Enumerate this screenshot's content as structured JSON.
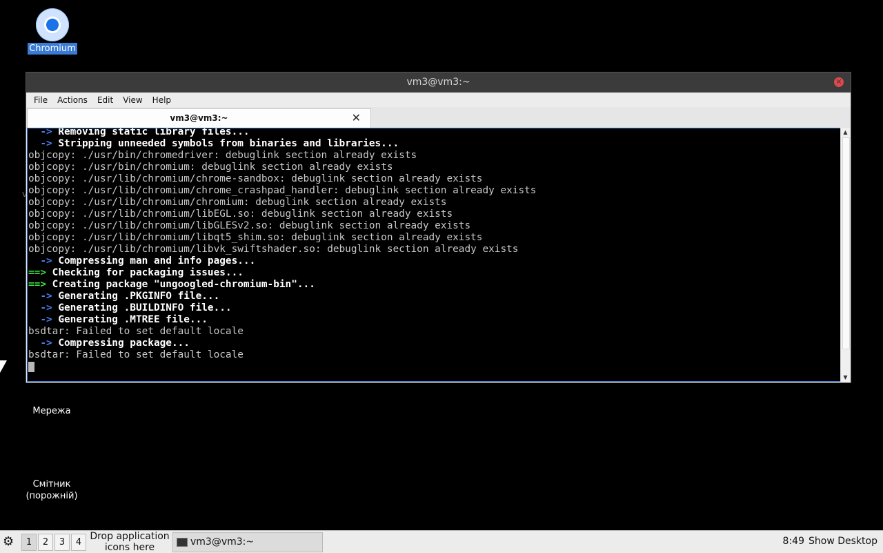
{
  "desktop": {
    "chromium_label": "Chromium",
    "network_label": "Мережа",
    "trash_label": "Смітник (порожній)"
  },
  "window": {
    "title": "vm3@vm3:~",
    "menu": [
      "File",
      "Actions",
      "Edit",
      "View",
      "Help"
    ],
    "tab_title": "vm3@vm3:~",
    "terminal_lines": [
      {
        "prefix": "  -> ",
        "prefix_color": "blue",
        "text": "Removing static library files...",
        "bold": true
      },
      {
        "prefix": "  -> ",
        "prefix_color": "blue",
        "text": "Stripping unneeded symbols from binaries and libraries...",
        "bold": true
      },
      {
        "text": "objcopy: ./usr/bin/chromedriver: debuglink section already exists"
      },
      {
        "text": "objcopy: ./usr/bin/chromium: debuglink section already exists"
      },
      {
        "text": "objcopy: ./usr/lib/chromium/chrome-sandbox: debuglink section already exists"
      },
      {
        "text": "objcopy: ./usr/lib/chromium/chrome_crashpad_handler: debuglink section already exists"
      },
      {
        "text": "objcopy: ./usr/lib/chromium/chromium: debuglink section already exists"
      },
      {
        "text": "objcopy: ./usr/lib/chromium/libEGL.so: debuglink section already exists"
      },
      {
        "text": "objcopy: ./usr/lib/chromium/libGLESv2.so: debuglink section already exists"
      },
      {
        "text": "objcopy: ./usr/lib/chromium/libqt5_shim.so: debuglink section already exists"
      },
      {
        "text": "objcopy: ./usr/lib/chromium/libvk_swiftshader.so: debuglink section already exists"
      },
      {
        "prefix": "  -> ",
        "prefix_color": "blue",
        "text": "Compressing man and info pages...",
        "bold": true
      },
      {
        "prefix": "==> ",
        "prefix_color": "green",
        "text": "Checking for packaging issues...",
        "bold": true
      },
      {
        "prefix": "==> ",
        "prefix_color": "green",
        "text": "Creating package \"ungoogled-chromium-bin\"...",
        "bold": true
      },
      {
        "prefix": "  -> ",
        "prefix_color": "blue",
        "text": "Generating .PKGINFO file...",
        "bold": true
      },
      {
        "prefix": "  -> ",
        "prefix_color": "blue",
        "text": "Generating .BUILDINFO file...",
        "bold": true
      },
      {
        "prefix": "  -> ",
        "prefix_color": "blue",
        "text": "Generating .MTREE file...",
        "bold": true
      },
      {
        "text": "bsdtar: Failed to set default locale"
      },
      {
        "prefix": "  -> ",
        "prefix_color": "blue",
        "text": "Compressing package...",
        "bold": true
      },
      {
        "text": "bsdtar: Failed to set default locale"
      }
    ]
  },
  "taskbar": {
    "workspaces": [
      "1",
      "2",
      "3",
      "4"
    ],
    "drop_text": "Drop application icons here",
    "task_label": "vm3@vm3:~",
    "clock": "8:49",
    "show_desktop": "Show Desktop"
  },
  "colors": {
    "arrow_blue": "#4a7ef0",
    "arrow_green": "#3fe03f",
    "terminal_bg": "#000000",
    "selection": "#3a7bd5"
  },
  "icons": [
    "chromium-icon",
    "close-icon",
    "tab-close-icon",
    "start-menu-icon",
    "terminal-icon",
    "mouse-pointer-icon"
  ]
}
